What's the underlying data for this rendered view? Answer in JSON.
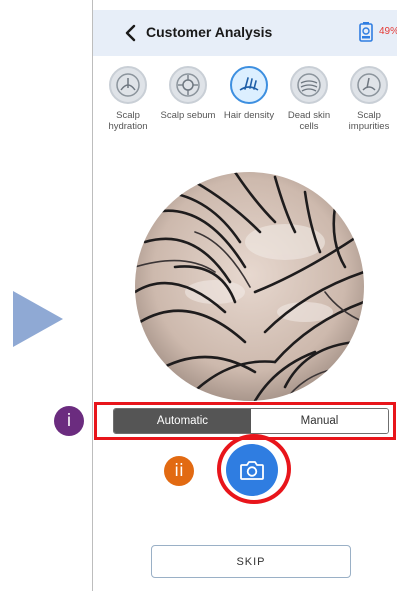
{
  "header": {
    "title": "Customer Analysis",
    "battery": "49%"
  },
  "categories": [
    {
      "label": "Scalp hydration",
      "icon": "hydration-icon",
      "active": false
    },
    {
      "label": "Scalp sebum",
      "icon": "sebum-icon",
      "active": false
    },
    {
      "label": "Hair density",
      "icon": "density-icon",
      "active": true
    },
    {
      "label": "Dead skin cells",
      "icon": "dead-skin-icon",
      "active": false
    },
    {
      "label": "Scalp impurities",
      "icon": "impurities-icon",
      "active": false
    }
  ],
  "mode": {
    "automatic": "Automatic",
    "manual": "Manual",
    "selected": "Automatic"
  },
  "skip_label": "SKIP",
  "annotations": {
    "mark_1": "i",
    "mark_2": "ii"
  },
  "colors": {
    "accent": "#2f7de1",
    "highlight": "#e8151b",
    "badge_1": "#6b2c7f",
    "badge_2": "#e26a12"
  }
}
